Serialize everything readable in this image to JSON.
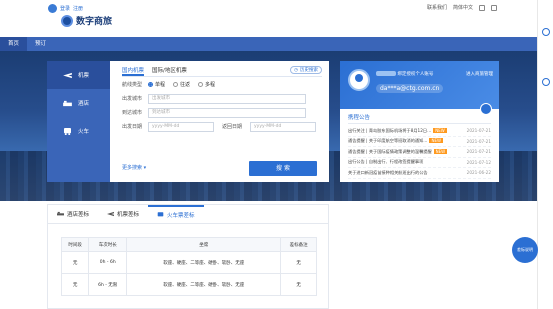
{
  "topbar": {
    "login_links": [
      "登录",
      "注册"
    ],
    "app_title": "数字商旅",
    "right_links": [
      "联系我们",
      "简体中文"
    ]
  },
  "nav": {
    "items": [
      "首页",
      "预订"
    ]
  },
  "panel": {
    "side_tabs": [
      "机票",
      "酒店",
      "火车"
    ],
    "form_tabs": [
      "国内机票",
      "国际/地区机票"
    ],
    "history_label": "历史搜索",
    "trip_type_label": "航线类型",
    "trip_types": [
      "单程",
      "往返",
      "多程"
    ],
    "from_label": "出发城市",
    "from_placeholder": "出发城市",
    "to_label": "到达城市",
    "to_placeholder": "到达城市",
    "depart_label": "出发日期",
    "depart_placeholder": "yyyy-MM-dd",
    "return_label": "返回日期",
    "return_placeholder": "yyyy-MM-dd",
    "more_label": "更多搜索",
    "search_label": "搜 索"
  },
  "card": {
    "greeting_suffix": "绑定授权个人账号",
    "email": "da***a@ctg.com.cn",
    "goto_label": "进入商旅管理",
    "announcements_title": "携程公告",
    "announcements": [
      {
        "text": "出行关注 | 青岛胶东国际机场将于8月12日…",
        "tag": "NEW",
        "date": "2021-07-21"
      },
      {
        "text": "通告提醒 | 关于印度航空等班取消的通知…",
        "tag": "NEW",
        "date": "2021-07-21"
      },
      {
        "text": "通告提醒 | 关于国际疫情政策调整的温馨提醒",
        "tag": "NEW",
        "date": "2021-07-21"
      },
      {
        "text": "出行公告 | 自制出行、行程改签提醒事项",
        "tag": "",
        "date": "2021-07-12"
      },
      {
        "text": "关于进口新冠疫苗接种相关航班出行的公告",
        "tag": "",
        "date": "2021-06-22"
      }
    ]
  },
  "lower": {
    "tabs": [
      "酒店差标",
      "机票差标",
      "火车票差标"
    ],
    "table": {
      "headers": [
        "时间段",
        "车次时长",
        "坐席",
        "差标备注"
      ],
      "rows": [
        [
          "无",
          "0h - 6h",
          "软座、硬座、二等座、硬卧、软卧、无座",
          "无"
        ],
        [
          "无",
          "6h - 无限",
          "软座、硬座、二等座、硬卧、软卧、无座",
          "无"
        ]
      ]
    }
  },
  "fab_label": "差标说明"
}
